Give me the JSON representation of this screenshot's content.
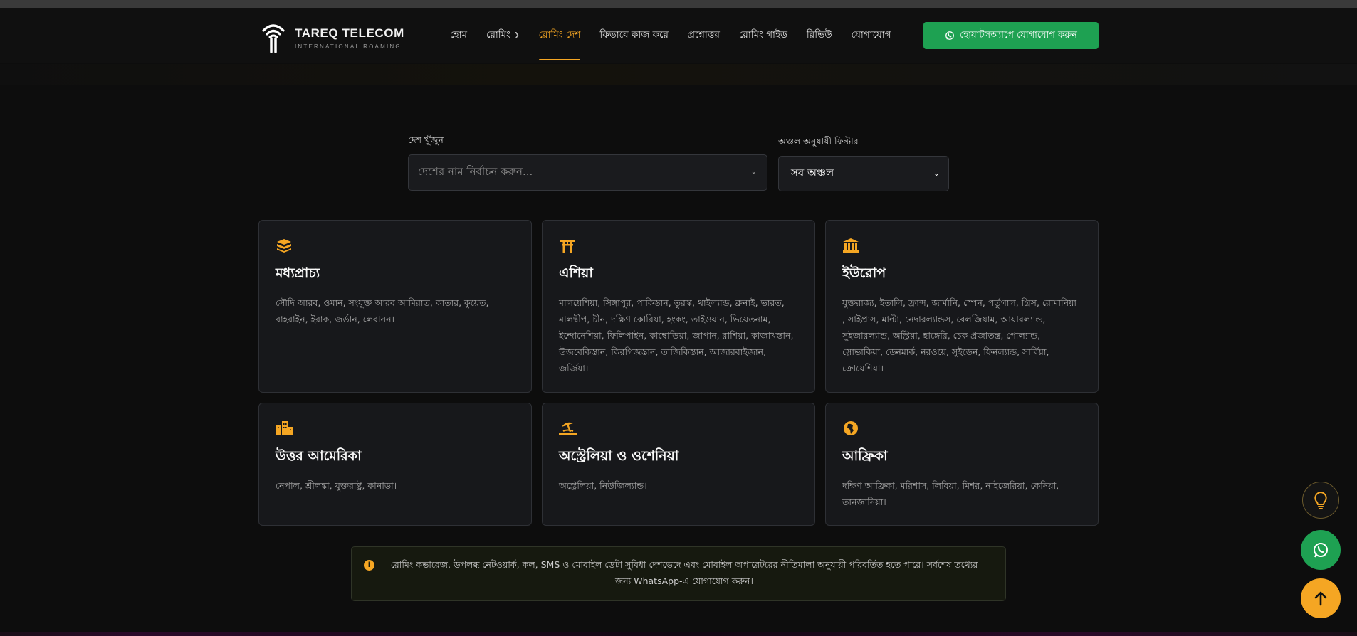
{
  "brand": {
    "title": "TAREQ TELECOM",
    "subtitle": "INTERNATIONAL ROAMING"
  },
  "nav": {
    "items": [
      {
        "label": "হোম"
      },
      {
        "label": "রোমিং"
      },
      {
        "label": "রোমিং দেশ"
      },
      {
        "label": "কিভাবে কাজ করে"
      },
      {
        "label": "প্রশ্নোত্তর"
      },
      {
        "label": "রোমিং গাইড"
      },
      {
        "label": "রিভিউ"
      },
      {
        "label": "যোগাযোগ"
      }
    ],
    "active_index": 2,
    "whatsapp_label": "হোয়াটসঅ্যাপে যোগাযোগ করুন"
  },
  "filters": {
    "search_label": "দেশ খুঁজুন",
    "search_placeholder": "দেশের নাম নির্বাচন করুন...",
    "region_label": "অঞ্চল অনুযায়ী ফিল্টার",
    "region_value": "সব অঞ্চল"
  },
  "regions": [
    {
      "title": "মধ্যপ্রাচ্য",
      "icon": "kaaba-icon",
      "countries": "সৌদি আরব, ওমান, সংযুক্ত আরব আমিরাত, কাতার, কুয়েত, বাহরাইন, ইরাক, জর্ডান, লেবানন।"
    },
    {
      "title": "এশিয়া",
      "icon": "torii-gate-icon",
      "countries": "মালয়েশিয়া, সিঙ্গাপুর, পাকিস্তান, তুরস্ক, থাইল্যান্ড, ব্রুনাই, ভারত, মালদ্বীপ, চীন, দক্ষিণ কোরিয়া, হংকং, তাইওয়ান, ভিয়েতনাম, ইন্দোনেশিয়া, ফিলিপাইন, কাম্বোডিয়া, জাপান, রাশিয়া, কাজাখস্তান, উজবেকিস্তান, কিরগিজস্তান, তাজিকিস্তান, আজারবাইজান, জর্জিয়া।"
    },
    {
      "title": "ইউরোপ",
      "icon": "landmark-icon",
      "countries": "যুক্তরাজ্য, ইতালি, ফ্রান্স, জার্মানি, স্পেন, পর্তুগাল, গ্রিস, রোমানিয়া , সাইপ্রাস, মাল্টা, নেদারল্যান্ডস, বেলজিয়াম, আয়ারল্যান্ড, সুইজারল্যান্ড, অস্ট্রিয়া, হাঙ্গেরি, চেক প্রজাতন্ত্র, পোল্যান্ড, স্লোভাকিয়া, ডেনমার্ক, নরওয়ে, সুইডেন, ফিনল্যান্ড, সার্বিয়া, ক্রোয়েশিয়া।"
    },
    {
      "title": "উত্তর আমেরিকা",
      "icon": "city-icon",
      "countries": "নেপাল, শ্রীলঙ্কা, যুক্তরাষ্ট্র, কানাডা।"
    },
    {
      "title": "অস্ট্রেলিয়া ও ওশেনিয়া",
      "icon": "umbrella-beach-icon",
      "countries": "অস্ট্রেলিয়া, নিউজিল্যান্ড।"
    },
    {
      "title": "আফ্রিকা",
      "icon": "globe-africa-icon",
      "countries": "দক্ষিণ আফ্রিকা, মরিশাস, লিবিয়া, মিশর, নাইজেরিয়া, কেনিয়া, তানজানিয়া।"
    }
  ],
  "notice": "রোমিং কভারেজ, উপলব্ধ নেটওয়ার্ক, কল, SMS ও মোবাইল ডেটা সুবিধা দেশভেদে এবং মোবাইল অপারেটরের নীতিমালা অনুযায়ী পরিবর্তিত হতে পারে। সর্বশেষ তথ্যের জন্য WhatsApp-এ যোগাযোগ করুন।",
  "colors": {
    "accent": "#f5a623",
    "whatsapp": "#1ea152",
    "background": "#0d0d0d"
  }
}
